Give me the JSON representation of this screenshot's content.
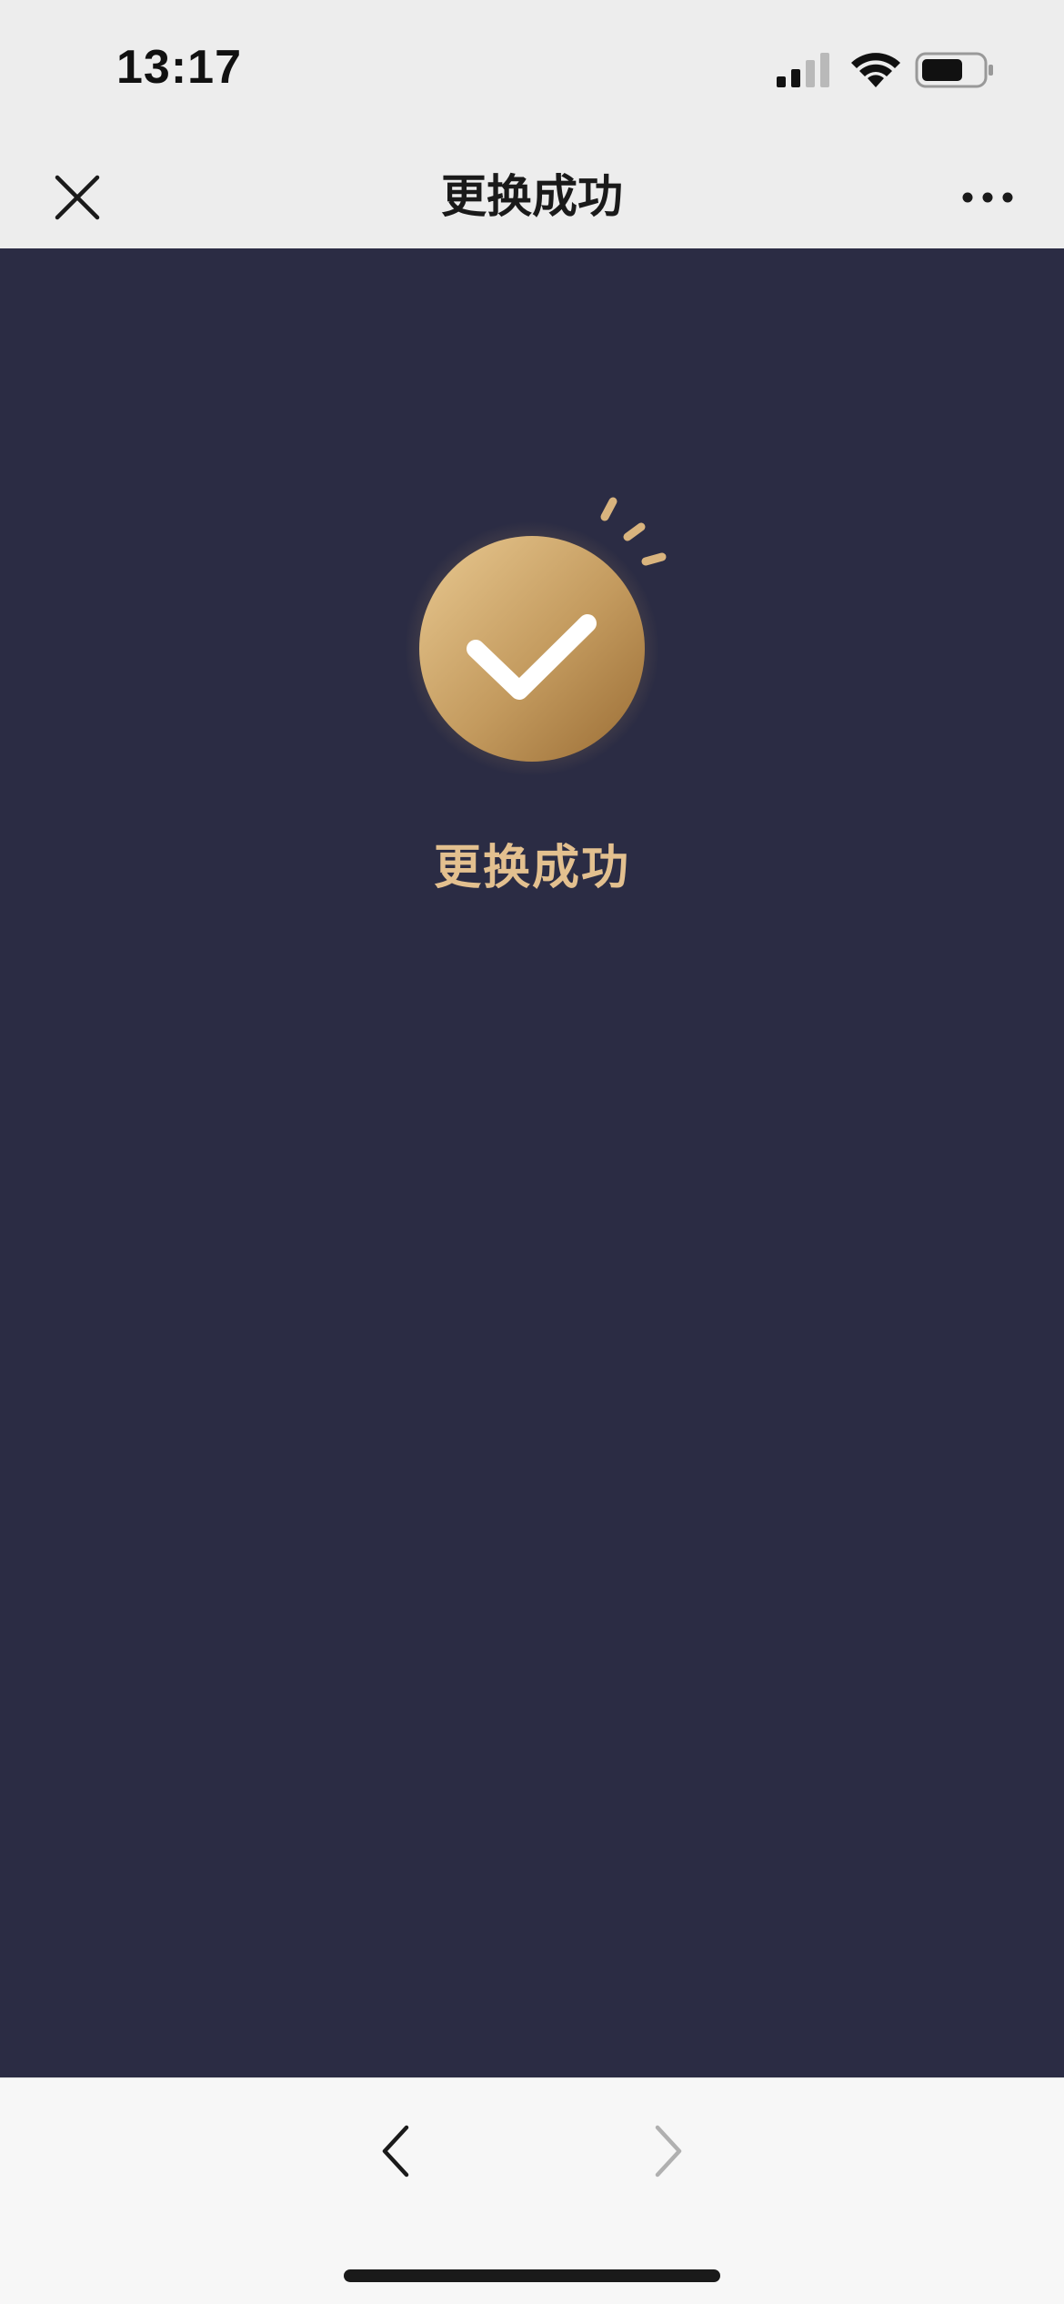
{
  "status_bar": {
    "time": "13:17",
    "signal_icon": "cellular-signal-icon",
    "wifi_icon": "wifi-icon",
    "battery_icon": "battery-icon"
  },
  "nav": {
    "title": "更换成功",
    "close_icon": "close-icon",
    "more_icon": "more-icon"
  },
  "main": {
    "success_icon": "check-circle-icon",
    "message": "更换成功"
  },
  "toolbar": {
    "back_icon": "chevron-left-icon",
    "forward_icon": "chevron-right-icon"
  },
  "colors": {
    "background": "#2b2c44",
    "accent_gold": "#e3c08f",
    "nav_background": "#ededed"
  }
}
